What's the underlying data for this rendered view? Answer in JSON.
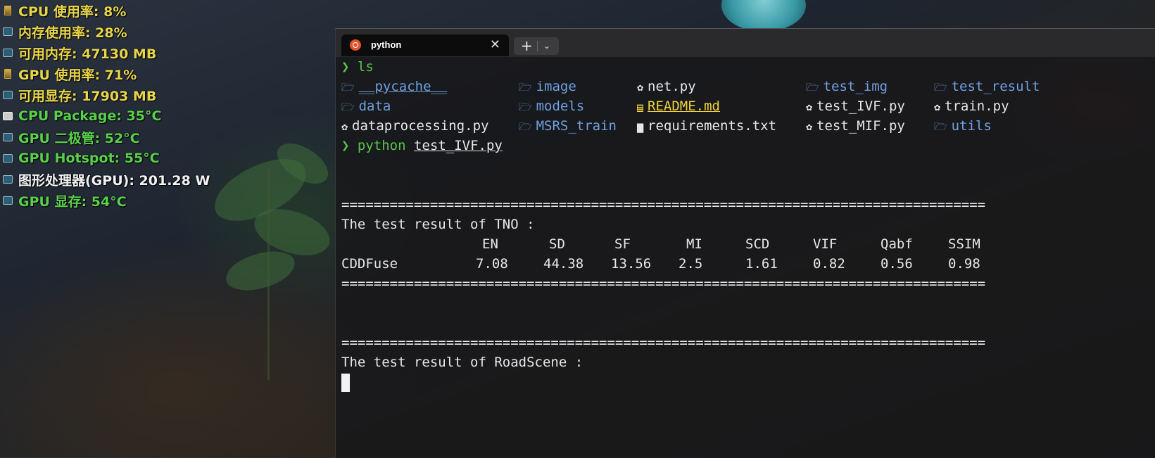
{
  "monitor": {
    "rows": [
      {
        "text": "CPU 使用率: 8%",
        "color": "#e8d54a",
        "icon": "hourglass-icon"
      },
      {
        "text": "内存使用率: 28%",
        "color": "#e8d54a",
        "icon": "memory-icon"
      },
      {
        "text": "可用内存: 47130 MB",
        "color": "#e8d54a",
        "icon": "memory-icon"
      },
      {
        "text": "GPU 使用率: 71%",
        "color": "#e8d54a",
        "icon": "hourglass-icon"
      },
      {
        "text": "可用显存: 17903 MB",
        "color": "#e8d54a",
        "icon": "memory-icon"
      },
      {
        "text": "CPU Package: 35°C",
        "color": "#59d04a",
        "icon": "chip-icon"
      },
      {
        "text": "GPU 二极管: 52°C",
        "color": "#59d04a",
        "icon": "monitor-icon"
      },
      {
        "text": "GPU Hotspot: 55°C",
        "color": "#59d04a",
        "icon": "monitor-icon"
      },
      {
        "text": "图形处理器(GPU): 201.28 W",
        "color": "#f2f2f2",
        "icon": "monitor-icon"
      },
      {
        "text": "GPU 显存: 54°C",
        "color": "#59d04a",
        "icon": "monitor-icon"
      }
    ]
  },
  "terminal": {
    "tab_title": "python",
    "tab_close": "✕",
    "new_tab": "+",
    "dropdown": "⌄",
    "prompt_symbol": "❯",
    "cmd1": "ls",
    "ls": {
      "col1": [
        {
          "name": "__pycache__",
          "kind": "dir"
        },
        {
          "name": "data",
          "kind": "dir"
        },
        {
          "name": "dataprocessing.py",
          "kind": "py"
        }
      ],
      "col2": [
        {
          "name": "image",
          "kind": "dir"
        },
        {
          "name": "models",
          "kind": "dir"
        },
        {
          "name": "MSRS_train",
          "kind": "dir"
        }
      ],
      "col3": [
        {
          "name": "net.py",
          "kind": "py"
        },
        {
          "name": "README.md",
          "kind": "md"
        },
        {
          "name": "requirements.txt",
          "kind": "txt"
        }
      ],
      "col4": [
        {
          "name": "test_img",
          "kind": "dir"
        },
        {
          "name": "test_IVF.py",
          "kind": "py"
        },
        {
          "name": "test_MIF.py",
          "kind": "py"
        }
      ],
      "col5": [
        {
          "name": "test_result",
          "kind": "dir"
        },
        {
          "name": "train.py",
          "kind": "py"
        },
        {
          "name": "utils",
          "kind": "dir"
        }
      ]
    },
    "cmd2_program": "python",
    "cmd2_arg": "test_IVF.py",
    "separator": "================================================================================",
    "result1_title": "The test result of TNO :",
    "table_headers": [
      "EN",
      "SD",
      "SF",
      "MI",
      "SCD",
      "VIF",
      "Qabf",
      "SSIM"
    ],
    "table_row_name": "CDDFuse",
    "table_row_values": [
      "7.08",
      "44.38",
      "13.56",
      "2.5",
      "1.61",
      "0.82",
      "0.56",
      "0.98"
    ],
    "result2_title": "The test result of RoadScene :"
  }
}
